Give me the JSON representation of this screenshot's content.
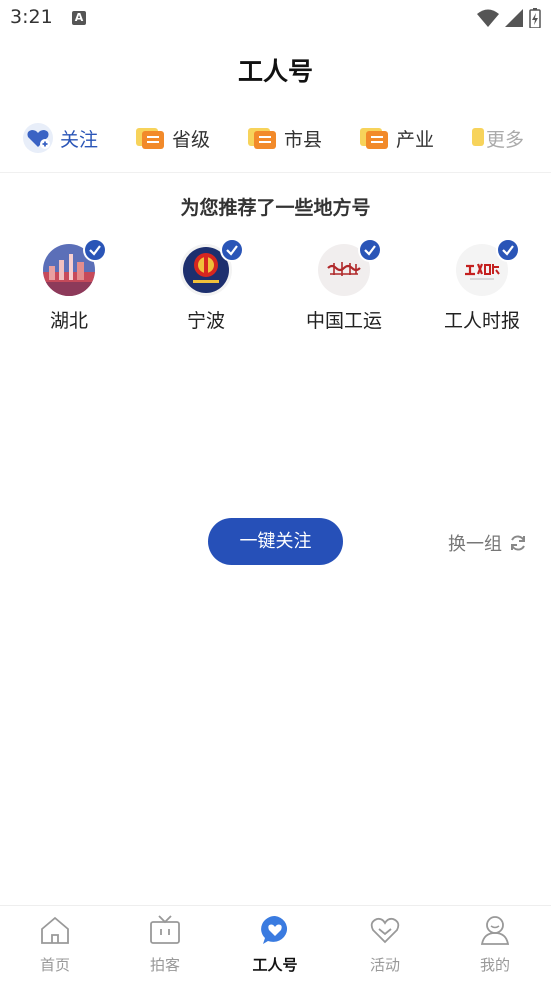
{
  "status": {
    "time": "3:21",
    "notif_glyph": "A"
  },
  "header": {
    "title": "工人号"
  },
  "tabs": [
    {
      "label": "关注",
      "icon": "heart-plus-icon",
      "active": true
    },
    {
      "label": "省级",
      "icon": "folder-list-icon"
    },
    {
      "label": "市县",
      "icon": "folder-list-icon"
    },
    {
      "label": "产业",
      "icon": "folder-list-icon"
    },
    {
      "label": "更多",
      "icon": "folder-list-icon"
    }
  ],
  "recommend": {
    "title": "为您推荐了一些地方号",
    "accounts": [
      {
        "name": "湖北"
      },
      {
        "name": "宁波"
      },
      {
        "name": "中国工运"
      },
      {
        "name": "工人时报"
      }
    ],
    "follow_all_label": "一键关注",
    "refresh_label": "换一组"
  },
  "bottom_nav": [
    {
      "label": "首页",
      "icon": "home-icon"
    },
    {
      "label": "拍客",
      "icon": "tv-icon"
    },
    {
      "label": "工人号",
      "icon": "heart-chat-icon",
      "active": true
    },
    {
      "label": "活动",
      "icon": "heart-outline-icon"
    },
    {
      "label": "我的",
      "icon": "user-icon"
    }
  ],
  "colors": {
    "accent": "#2a55b7",
    "muted": "#999999"
  }
}
